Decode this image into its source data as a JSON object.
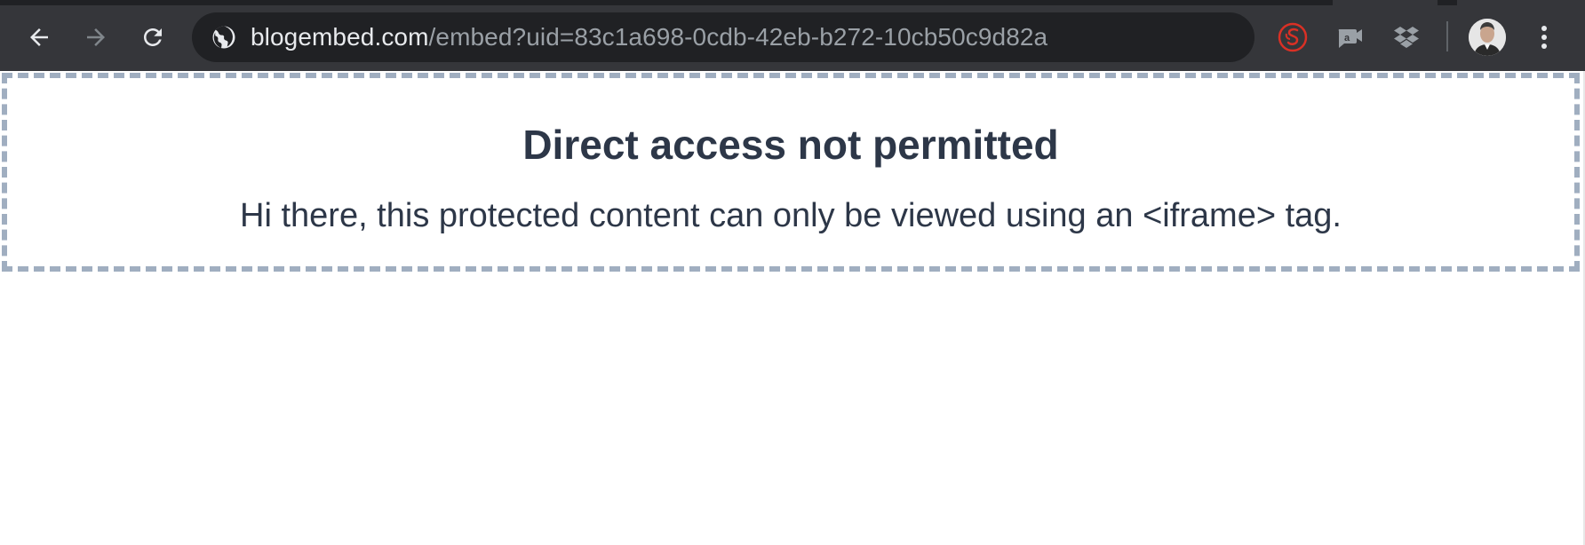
{
  "toolbar": {
    "back_icon": "arrow-left-icon",
    "forward_icon": "arrow-right-icon",
    "reload_icon": "reload-icon"
  },
  "address_bar": {
    "site_icon": "globe-icon",
    "domain": "blogembed.com",
    "path": "/embed?uid=83c1a698-0cdb-42eb-b272-10cb50c9d82a"
  },
  "extensions": [
    {
      "name": "red-circle-extension-icon",
      "color": "#d93025"
    },
    {
      "name": "chat-bubble-extension-icon"
    },
    {
      "name": "dropbox-icon"
    }
  ],
  "colors": {
    "toolbar_bg": "#35363a",
    "omnibox_bg": "#202124",
    "domain_text": "#e8eaed",
    "path_text": "#9aa0a6",
    "notice_text": "#2d3748",
    "notice_border": "#a0aec0"
  },
  "notice": {
    "title": "Direct access not permitted",
    "message": "Hi there, this protected content can only be viewed using an <iframe> tag."
  }
}
